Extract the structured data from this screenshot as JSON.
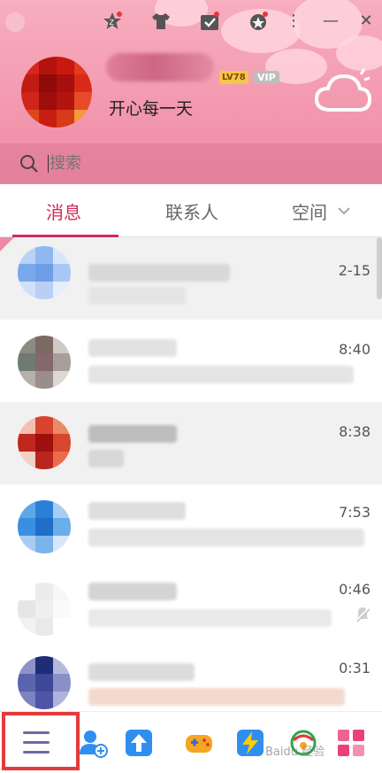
{
  "window": {
    "menu_glyph": "⋮",
    "minimize_glyph": "—",
    "close_glyph": "✕"
  },
  "profile": {
    "signature": "开心每一天",
    "level_badge": "LV78",
    "vip_badge": "VIP"
  },
  "search": {
    "placeholder": "搜索"
  },
  "tabs": [
    {
      "label": "消息",
      "active": true
    },
    {
      "label": "联系人",
      "active": false
    },
    {
      "label": "空间",
      "active": false
    }
  ],
  "chats": [
    {
      "time": "2-15",
      "muted": false,
      "pinned": true
    },
    {
      "time": "8:40",
      "muted": false,
      "pinned": false
    },
    {
      "time": "8:38",
      "muted": false,
      "pinned": false
    },
    {
      "time": "7:53",
      "muted": false,
      "pinned": false
    },
    {
      "time": "0:46",
      "muted": true,
      "pinned": false
    },
    {
      "time": "0:31",
      "muted": false,
      "pinned": false
    }
  ],
  "bottom_bar": {
    "icons": [
      "menu-icon",
      "add-friend-icon",
      "upload-icon",
      "game-icon",
      "lightning-icon",
      "sports-icon",
      "apps-grid-icon"
    ]
  },
  "watermark": "Baidu 经验",
  "colors": {
    "accent": "#d1295b",
    "header_pink": "#f39ab0",
    "highlight_box": "#e53a3a"
  }
}
